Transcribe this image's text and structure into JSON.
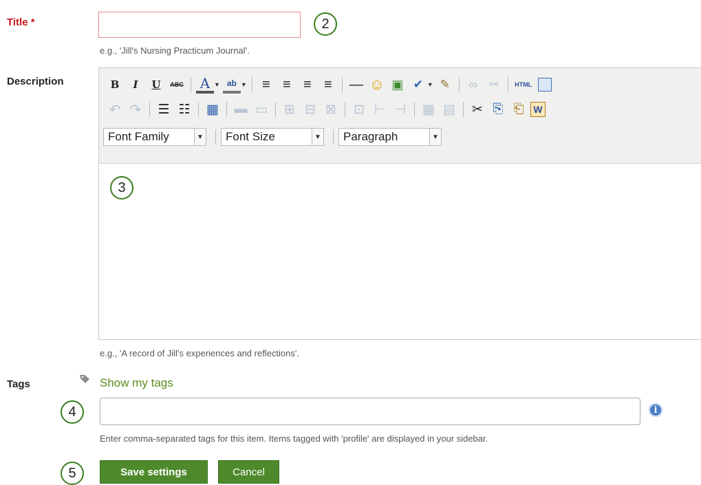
{
  "title_field": {
    "label": "Title *",
    "value": "",
    "hint": "e.g., 'Jill's Nursing Practicum Journal'."
  },
  "description_field": {
    "label": "Description",
    "hint": "e.g., 'A record of Jill's experiences and reflections'.",
    "editor": {
      "row1": [
        {
          "name": "bold-button",
          "glyph": "B"
        },
        {
          "name": "italic-button",
          "glyph": "I"
        },
        {
          "name": "underline-button",
          "glyph": "U"
        },
        {
          "name": "strikethrough-button",
          "glyph": "ABC"
        },
        {
          "name": "text-color-button",
          "glyph": "A"
        },
        {
          "name": "highlight-color-button",
          "glyph": "ab"
        },
        {
          "name": "align-left-button",
          "glyph": "≡"
        },
        {
          "name": "align-center-button",
          "glyph": "≡"
        },
        {
          "name": "align-right-button",
          "glyph": "≡"
        },
        {
          "name": "justify-button",
          "glyph": "≡"
        },
        {
          "name": "horizontal-rule-button",
          "glyph": "—"
        },
        {
          "name": "emoticon-button",
          "glyph": "☺"
        },
        {
          "name": "image-button",
          "glyph": "▣"
        },
        {
          "name": "spellcheck-button",
          "glyph": "✔"
        },
        {
          "name": "cleanup-button",
          "glyph": "✎"
        },
        {
          "name": "link-button",
          "glyph": "∞"
        },
        {
          "name": "unlink-button",
          "glyph": "⚯"
        },
        {
          "name": "html-source-button",
          "glyph": "HTML"
        }
      ],
      "row2_glyphs": [
        "↶",
        "↷",
        "☰",
        "☷",
        "▦",
        "▬",
        "▭",
        "⊞",
        "⊟",
        "⊠",
        "⊡",
        "⊢",
        "⊣",
        "▦",
        "▤",
        "✂",
        "⎘",
        "⎗",
        "W"
      ],
      "font_family": "Font Family",
      "font_size": "Font Size",
      "paragraph": "Paragraph"
    }
  },
  "tags_field": {
    "label": "Tags",
    "show_tags_link": "Show my tags",
    "value": "",
    "hint": "Enter comma-separated tags for this item. Items tagged with 'profile' are displayed in your sidebar."
  },
  "actions": {
    "save_label": "Save settings",
    "cancel_label": "Cancel"
  },
  "callouts": {
    "c2": "2",
    "c3": "3",
    "c4": "4",
    "c5": "5"
  },
  "colors": {
    "required": "#c8151b",
    "accent_green": "#4e8a2c",
    "link_green": "#5c8a1c",
    "info_blue": "#4b7fc5"
  }
}
